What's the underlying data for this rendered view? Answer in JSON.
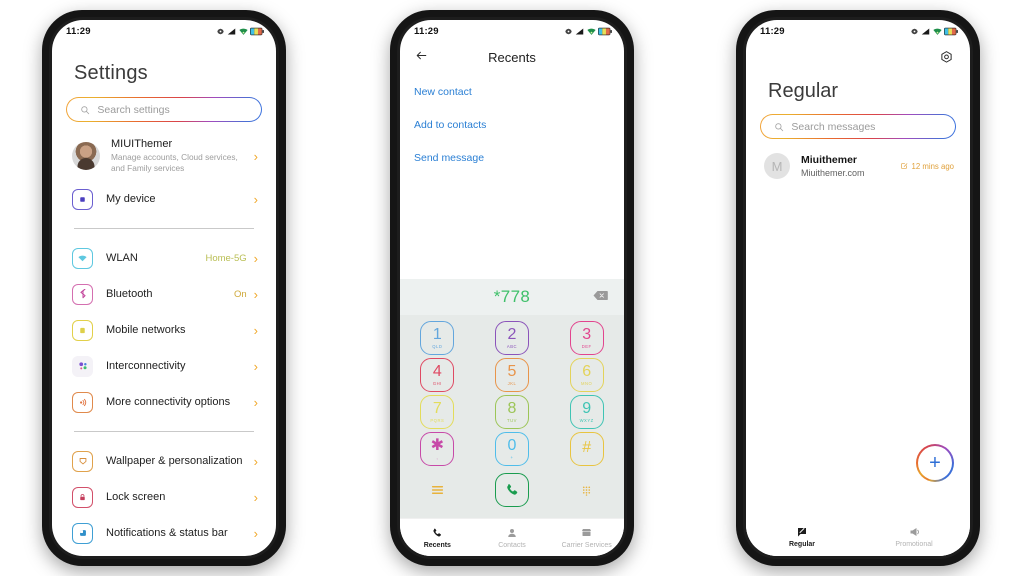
{
  "statusbar": {
    "time": "11:29",
    "icons": [
      "settings-sync-icon",
      "cellular-signal-icon",
      "wifi-icon",
      "battery-icon"
    ]
  },
  "settings_screen": {
    "title": "Settings",
    "search": {
      "placeholder": "Search settings",
      "icon": "search-icon"
    },
    "account": {
      "name": "MIUIThemer",
      "subtitle": "Manage accounts, Cloud services, and Family services",
      "chevron": "›"
    },
    "groups": [
      {
        "items": [
          {
            "label": "My device",
            "value": "",
            "icon": "device-icon",
            "color": "#6b5fd0"
          }
        ]
      },
      {
        "items": [
          {
            "label": "WLAN",
            "value": "Home-5G",
            "icon": "wifi-icon",
            "color": "#5ec8e0"
          },
          {
            "label": "Bluetooth",
            "value": "On",
            "icon": "bluetooth-icon",
            "color": "#d46fb0"
          },
          {
            "label": "Mobile networks",
            "value": "",
            "icon": "sim-card-icon",
            "color": "#e2d04a"
          },
          {
            "label": "Interconnectivity",
            "value": "",
            "icon": "interconnect-icon",
            "color": "#9a6fd0"
          },
          {
            "label": "More connectivity options",
            "value": "",
            "icon": "nfc-icon",
            "color": "#e08a4c"
          }
        ]
      },
      {
        "items": [
          {
            "label": "Wallpaper & personalization",
            "value": "",
            "icon": "wallpaper-icon",
            "color": "#e0a24c"
          },
          {
            "label": "Lock screen",
            "value": "",
            "icon": "lock-icon",
            "color": "#d2506a"
          },
          {
            "label": "Notifications & status bar",
            "value": "",
            "icon": "notifications-icon",
            "color": "#3f9fd4"
          }
        ]
      }
    ],
    "chevron": "›"
  },
  "dialer_screen": {
    "back_icon": "back-arrow-icon",
    "title": "Recents",
    "links": [
      "New contact",
      "Add to contacts",
      "Send message"
    ],
    "dialed_number": "*778",
    "backspace_icon": "backspace-icon",
    "keys": [
      {
        "num": "1",
        "sub": "QLD",
        "color": "#63a6dd"
      },
      {
        "num": "2",
        "sub": "ABC",
        "color": "#8b54ba"
      },
      {
        "num": "3",
        "sub": "DEF",
        "color": "#e2458e"
      },
      {
        "num": "4",
        "sub": "GHI",
        "color": "#df4a63"
      },
      {
        "num": "5",
        "sub": "JKL",
        "color": "#e8944a"
      },
      {
        "num": "6",
        "sub": "MNO",
        "color": "#e3d35a"
      },
      {
        "num": "7",
        "sub": "PQRS",
        "color": "#e3dc5a"
      },
      {
        "num": "8",
        "sub": "TUV",
        "color": "#9cc557"
      },
      {
        "num": "9",
        "sub": "WXYZ",
        "color": "#3fc4b4"
      },
      {
        "num": "✱",
        "sub": ",",
        "color": "#c74aa8"
      },
      {
        "num": "0",
        "sub": "+",
        "color": "#4fbdea"
      },
      {
        "num": "#",
        "sub": "",
        "color": "#e8c440"
      }
    ],
    "actions": {
      "menu_icon": "hamburger-menu-icon",
      "call_icon": "call-icon",
      "keypad_icon": "dialpad-icon"
    },
    "nav": [
      {
        "label": "Recents",
        "icon": "phone-icon",
        "active": true
      },
      {
        "label": "Contacts",
        "icon": "person-icon",
        "active": false
      },
      {
        "label": "Carrier Services",
        "icon": "store-icon",
        "active": false
      }
    ]
  },
  "messages_screen": {
    "settings_icon": "gear-icon",
    "title": "Regular",
    "search": {
      "placeholder": "Search messages",
      "icon": "search-icon"
    },
    "conversations": [
      {
        "avatar_letter": "M",
        "name": "Miuithemer",
        "preview": "Miuithemer.com",
        "time": "12 mins ago",
        "time_icon": "draft-icon"
      }
    ],
    "fab": {
      "icon": "plus-icon",
      "label": "+"
    },
    "nav": [
      {
        "label": "Regular",
        "icon": "message-icon",
        "active": true
      },
      {
        "label": "Promotional",
        "icon": "megaphone-icon",
        "active": false
      }
    ]
  }
}
